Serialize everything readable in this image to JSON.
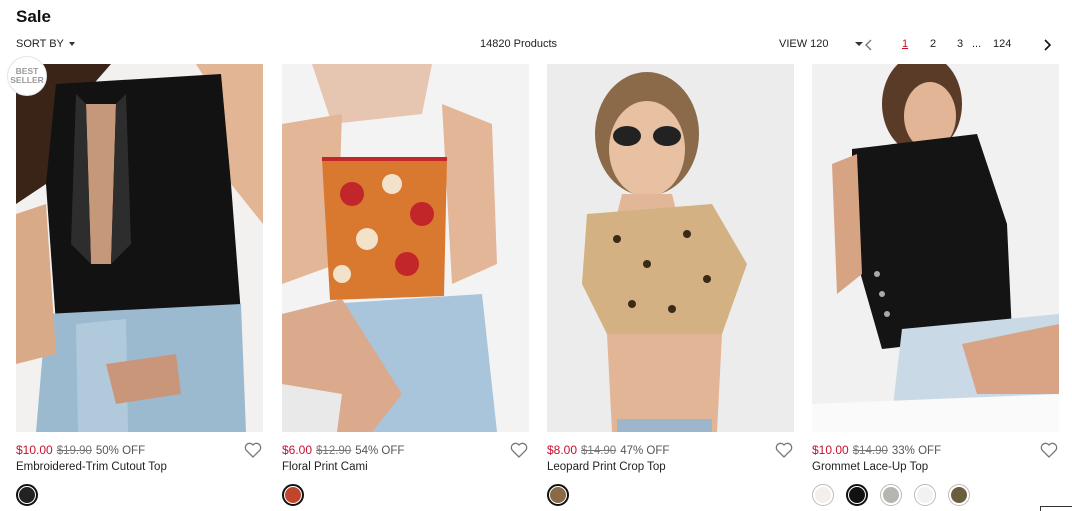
{
  "page": {
    "title": "Sale"
  },
  "toolbar": {
    "sort_label": "SORT BY",
    "product_count": "14820 Products",
    "view_label": "VIEW 120",
    "pages": [
      "1",
      "2",
      "3",
      "...",
      "124"
    ],
    "current_page": "1"
  },
  "badge": {
    "line1": "BEST",
    "line2": "SELLER"
  },
  "colors": {
    "sale_red": "#c8102e",
    "text": "#222222",
    "muted": "#777777"
  },
  "products": [
    {
      "name": "Embroidered-Trim Cutout Top",
      "price_sale": "$10.00",
      "price_original": "$19.90",
      "discount": "50% OFF",
      "swatches": [
        {
          "color": "#222222",
          "selected": true
        }
      ]
    },
    {
      "name": "Floral Print Cami",
      "price_sale": "$6.00",
      "price_original": "$12.90",
      "discount": "54% OFF",
      "swatches": [
        {
          "color": "#c0452b",
          "selected": true
        }
      ]
    },
    {
      "name": "Leopard Print Crop Top",
      "price_sale": "$8.00",
      "price_original": "$14.90",
      "discount": "47% OFF",
      "swatches": [
        {
          "color": "#8a6a45",
          "selected": true
        }
      ]
    },
    {
      "name": "Grommet Lace-Up Top",
      "price_sale": "$10.00",
      "price_original": "$14.90",
      "discount": "33% OFF",
      "swatches": [
        {
          "color": "#f4efe9",
          "selected": false
        },
        {
          "color": "#111111",
          "selected": true
        },
        {
          "color": "#b5b5b2",
          "selected": false
        },
        {
          "color": "#f2f2f2",
          "selected": false
        },
        {
          "color": "#6b5e3e",
          "selected": false
        }
      ]
    }
  ]
}
